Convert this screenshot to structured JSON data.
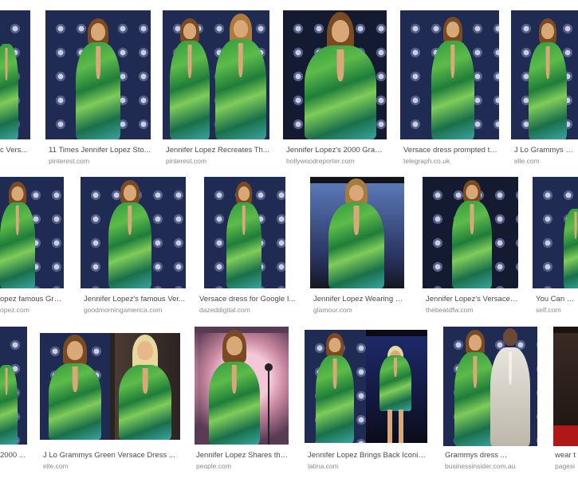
{
  "results": [
    {
      "caption": "c Vers...",
      "domain": ""
    },
    {
      "caption": "11 Times Jennifer Lopez Sto...",
      "domain": "pinterest.com"
    },
    {
      "caption": "Jennifer Lopez Recreates Th...",
      "domain": "pinterest.com"
    },
    {
      "caption": "Jennifer Lopez's 2000 Gram...",
      "domain": "hollywoodreporter.com"
    },
    {
      "caption": "Versace dress prompted th...",
      "domain": "telegraph.co.uk"
    },
    {
      "caption": "J Lo Grammys Gree",
      "domain": "elle.com"
    },
    {
      "caption": "opez famous Gra...",
      "domain": "opez.com"
    },
    {
      "caption": "Jennifer Lopez's famous Ver...",
      "domain": "goodmorningamerica.com"
    },
    {
      "caption": "Versace dress for Google I...",
      "domain": "dazeddigital.com"
    },
    {
      "caption": "Jennifer Lopez Wearing Gr...",
      "domain": "glamour.com"
    },
    {
      "caption": "Jennifer Lopez's Versace ...",
      "domain": "thebeatdfw.com"
    },
    {
      "caption": "You Can Nov",
      "domain": "self.com"
    },
    {
      "caption": "2000 ...",
      "domain": ""
    },
    {
      "caption": "J Lo Grammys Green Versace Dress ...",
      "domain": "elle.com"
    },
    {
      "caption": "Jennifer Lopez Shares the ...",
      "domain": "people.com"
    },
    {
      "caption": "Jennifer Lopez Brings Back Iconic ...",
      "domain": "latina.com"
    },
    {
      "caption": "Grammys dress ...",
      "domain": "businessinsider.com.au"
    },
    {
      "caption": "wear t",
      "domain": "pagesi"
    }
  ]
}
